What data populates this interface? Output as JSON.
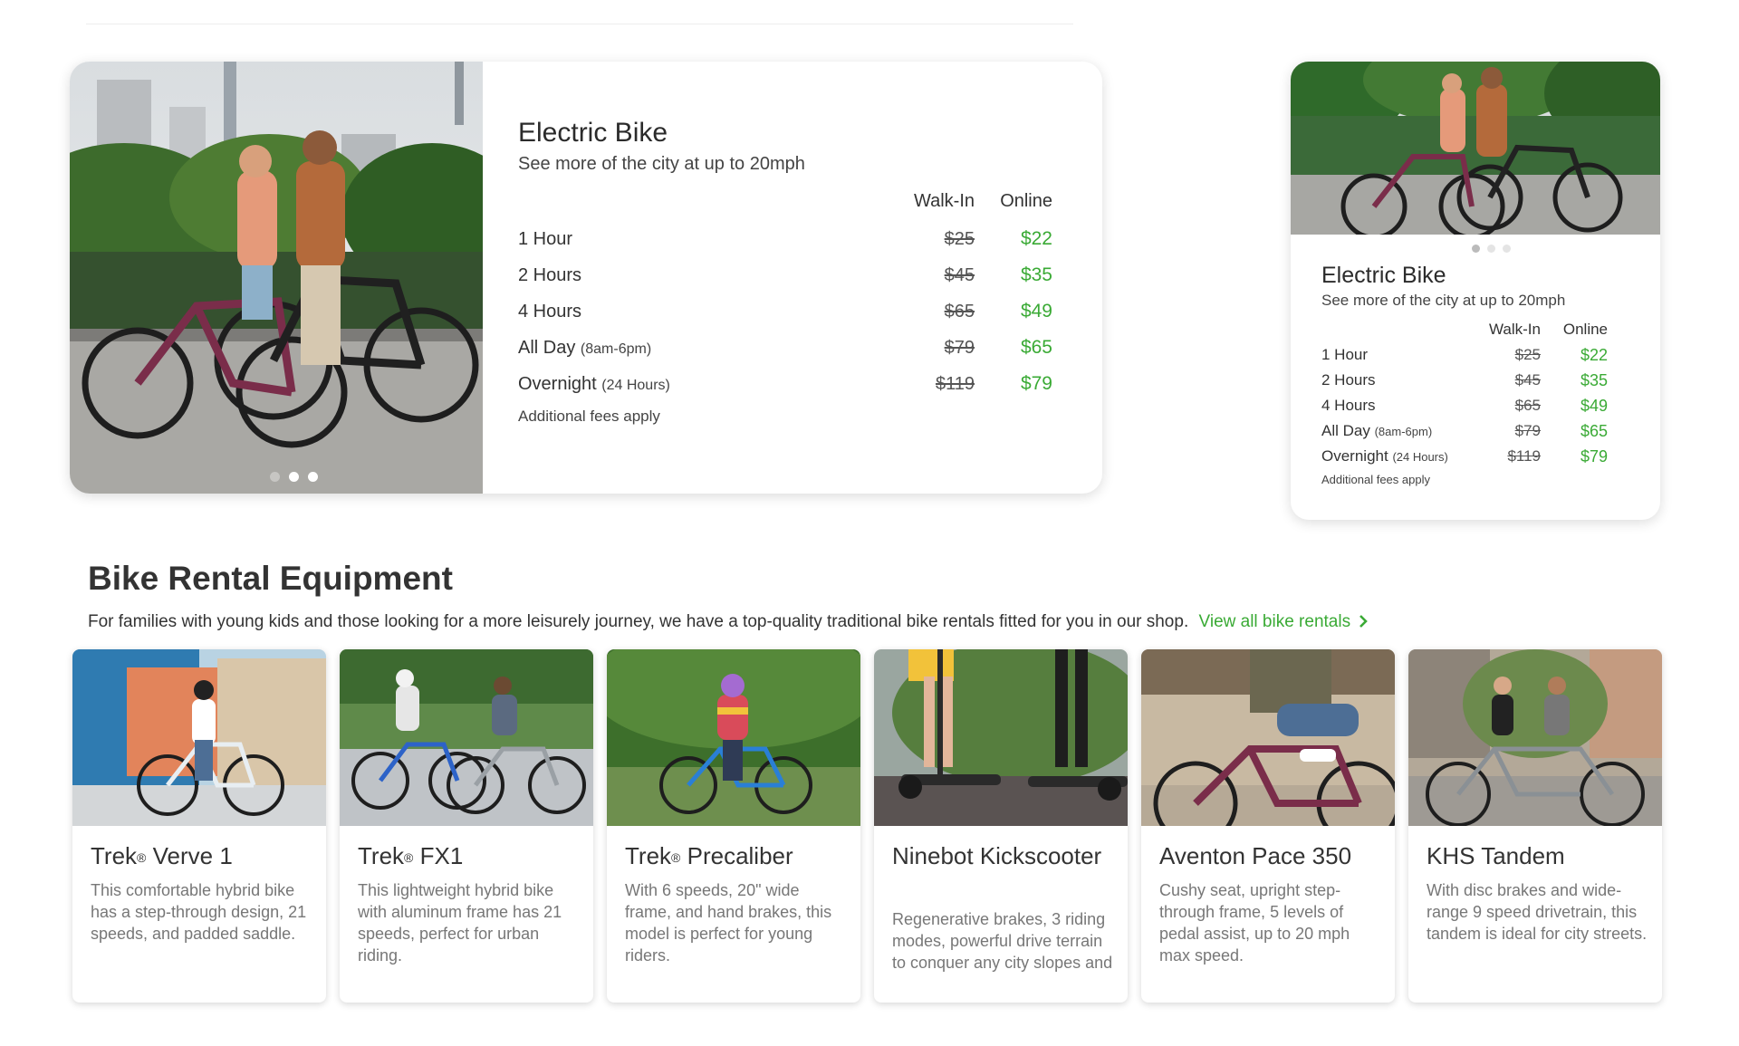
{
  "hero_card": {
    "title": "Electric Bike",
    "subtitle": "See more of the city at up to 20mph",
    "col_walkin": "Walk-In",
    "col_online": "Online",
    "rows": [
      {
        "label": "1 Hour",
        "note": "",
        "walkin": "$25",
        "online": "$22"
      },
      {
        "label": "2 Hours",
        "note": "",
        "walkin": "$45",
        "online": "$35"
      },
      {
        "label": "4 Hours",
        "note": "",
        "walkin": "$65",
        "online": "$49"
      },
      {
        "label": "All Day",
        "note": "(8am-6pm)",
        "walkin": "$79",
        "online": "$65"
      },
      {
        "label": "Overnight",
        "note": "(24 Hours)",
        "walkin": "$119",
        "online": "$79"
      }
    ],
    "fees_note": "Additional fees apply"
  },
  "section": {
    "title": "Bike Rental Equipment",
    "description": "For families with young kids and those looking for a more leisurely journey, we have a top-quality traditional bike rentals fitted for you in our shop.",
    "view_all_link": "View all bike rentals"
  },
  "equipment": [
    {
      "brand": "Trek",
      "model": "Verve 1",
      "registered": true,
      "description": "This comfortable hybrid bike has a step-through design, 21 speeds, and padded saddle."
    },
    {
      "brand": "Trek",
      "model": "FX1",
      "registered": true,
      "description": "This lightweight hybrid bike with aluminum frame has 21 speeds, perfect for urban riding."
    },
    {
      "brand": "Trek",
      "model": "Precaliber",
      "registered": true,
      "description": "With 6 speeds, 20\" wide frame, and hand brakes, this model is perfect for young riders."
    },
    {
      "brand": "",
      "model": "Ninebot Kickscooter",
      "registered": false,
      "description": "Regenerative brakes, 3 riding modes, powerful drive terrain to conquer any city slopes and hills."
    },
    {
      "brand": "",
      "model": "Aventon Pace 350",
      "registered": false,
      "description": "Cushy seat, upright step-through frame, 5 levels of pedal assist, up to 20 mph max speed."
    },
    {
      "brand": "",
      "model": "KHS Tandem",
      "registered": false,
      "description": "With disc brakes and wide-range 9 speed drivetrain, this tandem is ideal for city streets."
    }
  ],
  "colors": {
    "accent_green": "#3aaa35",
    "text_dark": "#333333",
    "text_muted": "#777777"
  },
  "icons": {
    "view_all": "chevron-right-icon"
  }
}
